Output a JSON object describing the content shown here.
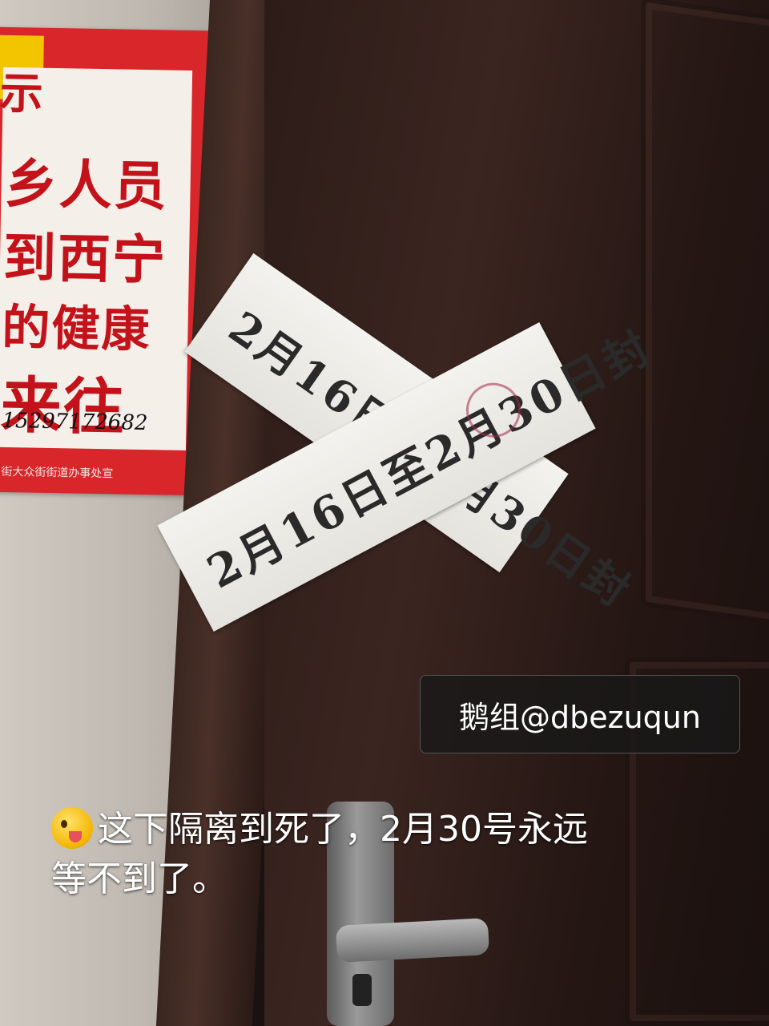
{
  "poster": {
    "lines": [
      "示",
      "乡人员",
      "到西宁",
      "的健康",
      "来往"
    ],
    "phone": "15297172682",
    "footer": "街大众街街道办事处宣"
  },
  "seals": {
    "paper_a": "2月16日至2月30日封",
    "paper_b": "2月16日至2月30日封",
    "stamp_label": "30"
  },
  "watermark": {
    "text": "鹅组@dbezuqun"
  },
  "caption": {
    "emoji": "winking-tongue-emoji",
    "line1": "这下隔离到死了，2月30号永远",
    "line2": "等不到了。"
  }
}
